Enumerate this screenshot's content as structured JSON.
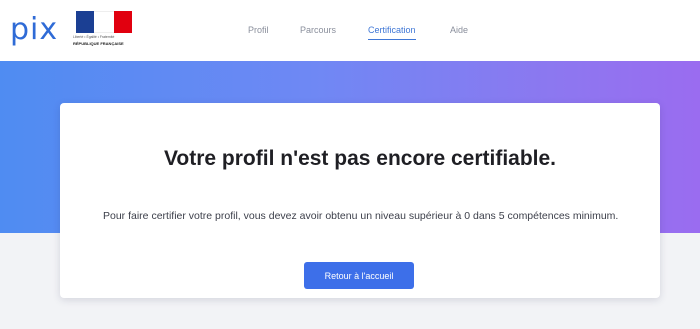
{
  "header": {
    "logo_text": "pix",
    "republic_logo": {
      "motto": "Liberté • Égalité • Fraternité",
      "name": "RÉPUBLIQUE FRANÇAISE",
      "colors": {
        "blue": "#1b3f93",
        "white": "#ffffff",
        "red": "#e1000f"
      }
    },
    "nav": [
      {
        "label": "Profil",
        "active": false
      },
      {
        "label": "Parcours",
        "active": false
      },
      {
        "label": "Certification",
        "active": true
      },
      {
        "label": "Aide",
        "active": false
      }
    ]
  },
  "hero": {
    "gradient": [
      "#4f8cf2",
      "#9a6cf0"
    ]
  },
  "card": {
    "title": "Votre profil n'est pas encore certifiable.",
    "message": "Pour faire certifier votre profil, vous devez avoir obtenu un niveau supérieur à 0 dans 5 compétences minimum.",
    "button_label": "Retour à l'accueil"
  },
  "colors": {
    "accent": "#3d6fe9",
    "nav_active": "#3f77d6",
    "nav_inactive": "#8a8f9c"
  }
}
